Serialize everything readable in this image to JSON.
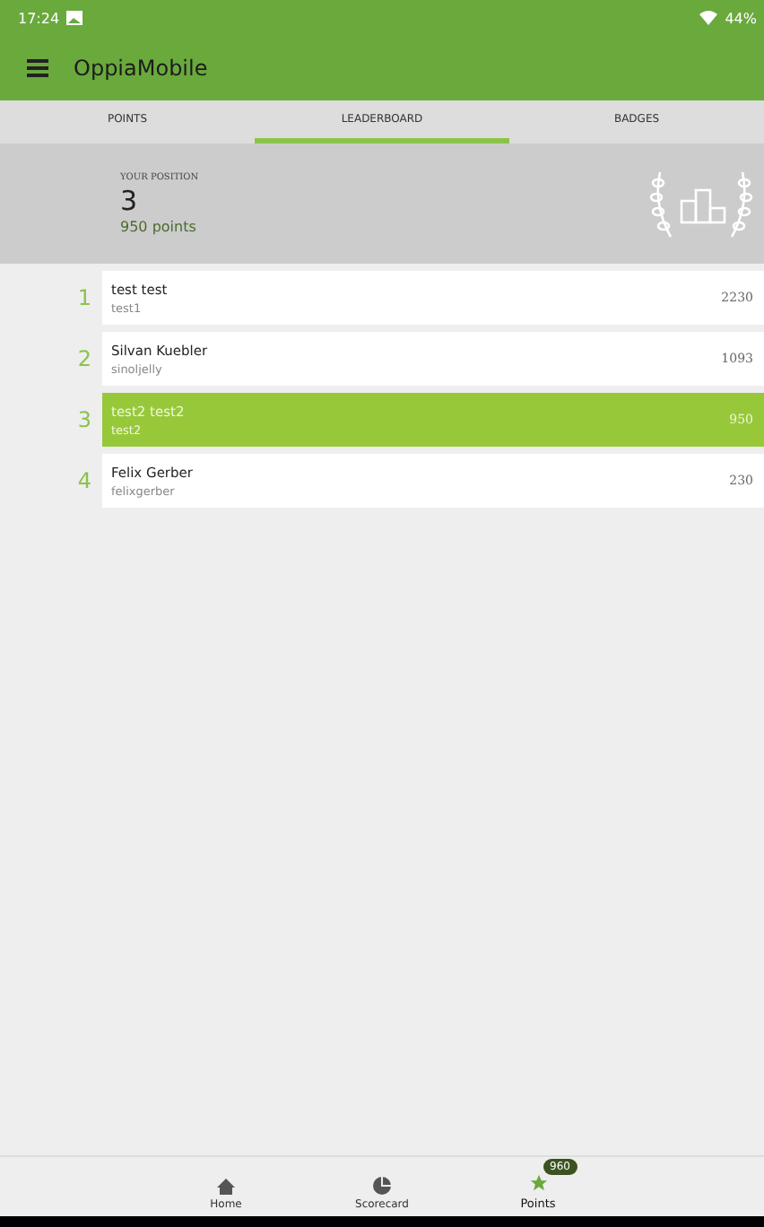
{
  "status_bar": {
    "time": "17:24",
    "battery": "44%"
  },
  "app_bar": {
    "title": "OppiaMobile"
  },
  "tabs": [
    {
      "label": "POINTS",
      "selected": false
    },
    {
      "label": "LEADERBOARD",
      "selected": true
    },
    {
      "label": "BADGES",
      "selected": false
    }
  ],
  "position": {
    "label": "YOUR POSITION",
    "rank": "3",
    "points": "950 points"
  },
  "leaderboard": [
    {
      "rank": "1",
      "name": "test test",
      "username": "test1",
      "points": "2230",
      "selected": false
    },
    {
      "rank": "2",
      "name": "Silvan Kuebler",
      "username": "sinoljelly",
      "points": "1093",
      "selected": false
    },
    {
      "rank": "3",
      "name": "test2 test2",
      "username": "test2",
      "points": "950",
      "selected": true
    },
    {
      "rank": "4",
      "name": "Felix Gerber",
      "username": "felixgerber",
      "points": "230",
      "selected": false
    }
  ],
  "bottom_nav": [
    {
      "kind": "home",
      "label": "Home",
      "selected": false
    },
    {
      "kind": "scorecard",
      "label": "Scorecard",
      "selected": false
    },
    {
      "kind": "points",
      "label": "Points",
      "selected": true,
      "badge": "960"
    }
  ]
}
